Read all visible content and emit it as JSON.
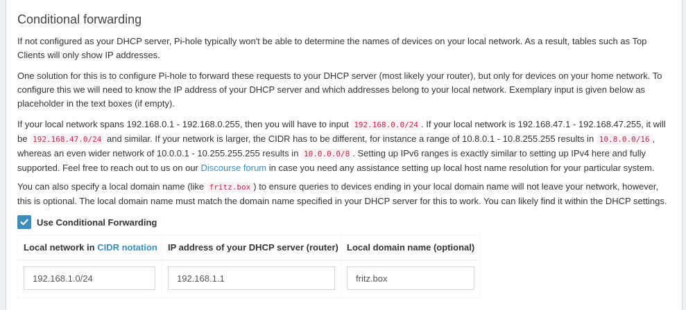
{
  "section": {
    "title": "Conditional forwarding",
    "para1": "If not configured as your DHCP server, Pi-hole typically won't be able to determine the names of devices on your local network. As a result, tables such as Top Clients will only show IP addresses.",
    "para2": "One solution for this is to configure Pi-hole to forward these requests to your DHCP server (most likely your router), but only for devices on your home network. To configure this we will need to know the IP address of your DHCP server and which addresses belong to your local network. Exemplary input is given below as placeholder in the text boxes (if empty).",
    "para3": {
      "t1": "If your local network spans 192.168.0.1 - 192.168.0.255, then you will have to input ",
      "c1": "192.168.0.0/24",
      "t2": ". If your local network is 192.168.47.1 - 192.168.47.255, it will be ",
      "c2": "192.168.47.0/24",
      "t3": " and similar. If your network is larger, the CIDR has to be different, for instance a range of 10.8.0.1 - 10.8.255.255 results in ",
      "c3": "10.8.0.0/16",
      "t4": ", whereas an even wider network of 10.0.0.1 - 10.255.255.255 results in ",
      "c4": "10.0.0.0/8",
      "t5": ". Setting up IPv6 ranges is exactly similar to setting up IPv4 here and fully supported. Feel free to reach out to us on our ",
      "link": "Discourse forum",
      "t6": " in case you need any assistance setting up local host name resolution for your particular system."
    },
    "para4": {
      "t1": "You can also specify a local domain name (like ",
      "c1": "fritz.box",
      "t2": ") to ensure queries to devices ending in your local domain name will not leave your network, however, this is optional. The local domain name must match the domain name specified in your DHCP server for this to work. You can likely find it within the DHCP settings."
    },
    "checkbox": {
      "label": "Use Conditional Forwarding",
      "checked": true
    },
    "table": {
      "col1_prefix": "Local network in ",
      "col1_link": "CIDR notation",
      "col2": "IP address of your DHCP server (router)",
      "col3": "Local domain name (optional)",
      "network_value": "192.168.1.0/24",
      "server_value": "192.168.1.1",
      "domain_value": "fritz.box"
    },
    "colors": {
      "accent": "#3c8dbc",
      "code": "#c7254e",
      "code_bg": "#f9f2f4"
    },
    "icons": {
      "checkbox": "checkmark-icon"
    }
  }
}
